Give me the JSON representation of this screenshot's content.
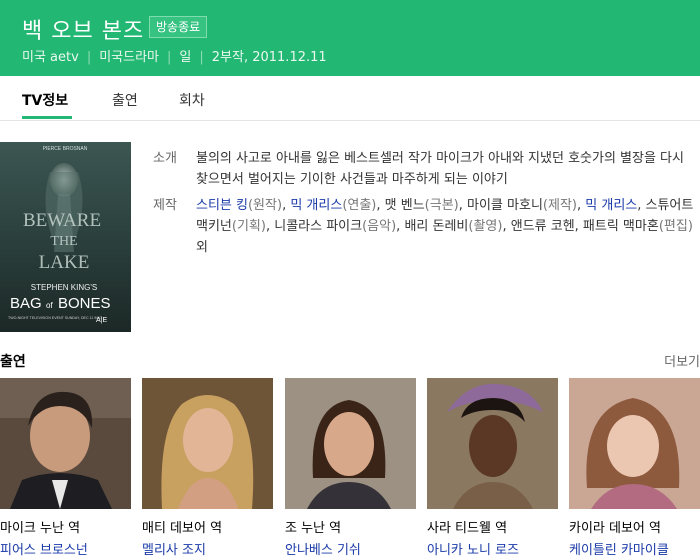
{
  "header": {
    "title": "백 오브 본즈",
    "status": "방송종료",
    "meta": [
      "미국 aetv",
      "미국드라마",
      "일",
      "2부작, 2011.12.11"
    ]
  },
  "tabs": [
    {
      "label": "TV정보",
      "active": true
    },
    {
      "label": "출연",
      "active": false
    },
    {
      "label": "회차",
      "active": false
    }
  ],
  "poster": {
    "top": "PIERCE BROSNAN",
    "line1": "BEWARE",
    "line2": "THE",
    "line3": "LAKE",
    "author": "STEPHEN KING'S",
    "brand1": "BAG",
    "brand2": "of",
    "brand3": "BONES",
    "bottom": "TWO-NIGHT TELEVISION EVENT\nSUNDAY, DEC 11 9/8C",
    "network": "A|E"
  },
  "info": {
    "intro_label": "소개",
    "intro_text": "불의의 사고로 아내를 잃은 베스트셀러 작가 마이크가 아내와 지냈던 호숫가의 별장을 다시 찾으면서 벌어지는 기이한 사건들과 마주하게 되는 이야기",
    "production_label": "제작",
    "production": [
      {
        "name": "스티븐 킹",
        "role": "(원작)",
        "link": true,
        "sep": ", "
      },
      {
        "name": "믹 개리스",
        "role": "(연출)",
        "link": true,
        "sep": ", "
      },
      {
        "name": "맷 벤느",
        "role": "(극본)",
        "link": false,
        "sep": ", "
      },
      {
        "name": "마이클 마호니",
        "role": "(제작)",
        "link": false,
        "sep": ", "
      },
      {
        "name": "믹 개리스",
        "role": "",
        "link": true,
        "sep": ", "
      },
      {
        "name": "스튜어트 맥키넌",
        "role": "(기획)",
        "link": false,
        "sep": ", "
      },
      {
        "name": "니콜라스 파이크",
        "role": "(음악)",
        "link": false,
        "sep": ", "
      },
      {
        "name": "배리 돈레비",
        "role": "(촬영)",
        "link": false,
        "sep": ", "
      },
      {
        "name": "앤드류 코헨",
        "role": "",
        "link": false,
        "sep": ", "
      },
      {
        "name": "패트릭 맥마혼",
        "role": "(편집)",
        "link": false,
        "sep": " "
      },
      {
        "name": "외",
        "role": "",
        "link": false,
        "sep": ""
      }
    ]
  },
  "cast_section": {
    "title": "출연",
    "more": "더보기"
  },
  "cast": [
    {
      "role": "마이크 누난 역",
      "actor": "피어스 브로스넌"
    },
    {
      "role": "매티 데보어 역",
      "actor": "멜리사 조지"
    },
    {
      "role": "조 누난 역",
      "actor": "안나베스 기쉬"
    },
    {
      "role": "사라 티드웰 역",
      "actor": "아니카 노니 로즈"
    },
    {
      "role": "카이라 데보어 역",
      "actor": "케이틀린 카마이클"
    }
  ],
  "colors": {
    "brand": "#22b772",
    "link": "#1a3aa8"
  }
}
